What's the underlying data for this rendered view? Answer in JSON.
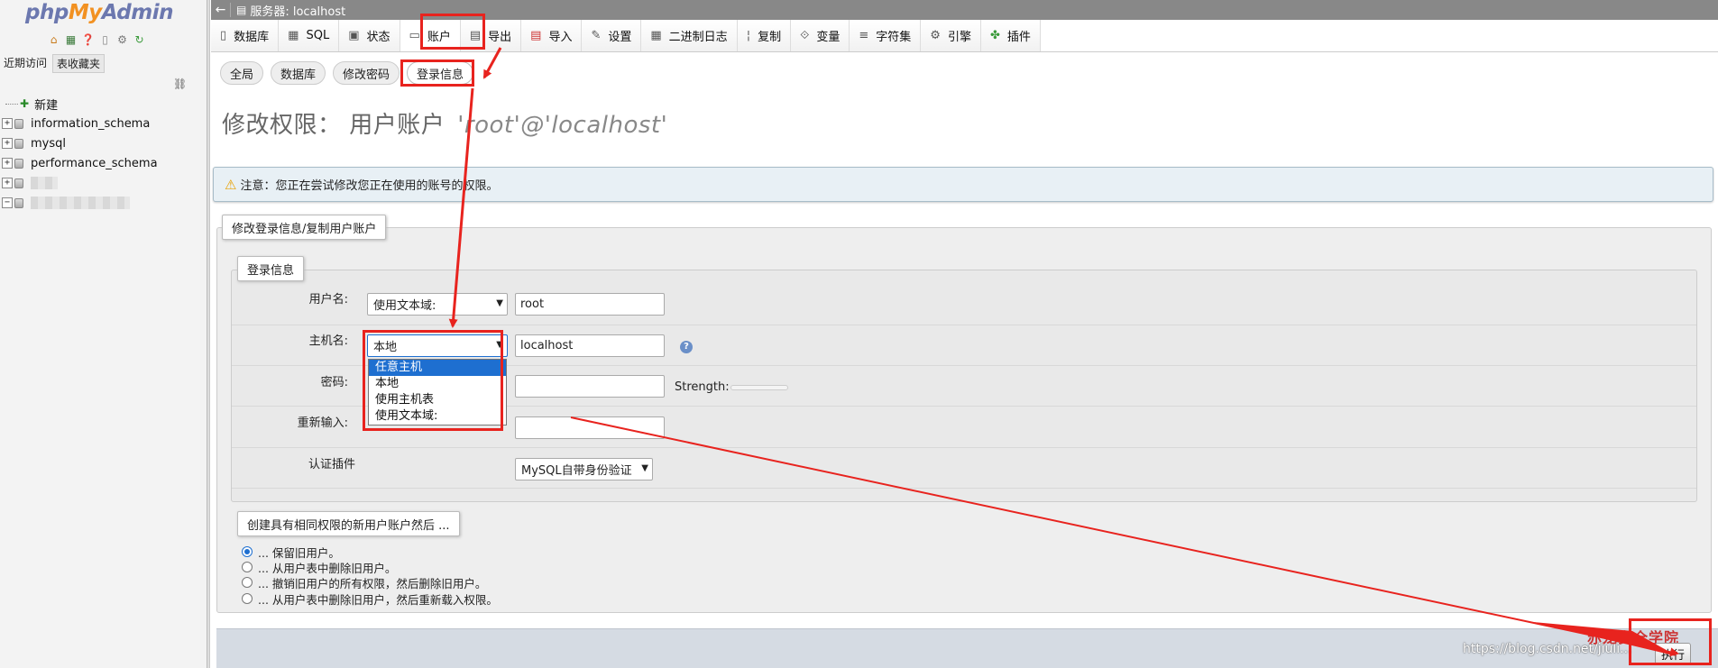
{
  "nav": {
    "logo_php": "php",
    "logo_my": "My",
    "logo_admin": "Admin",
    "icons": [
      "home-icon",
      "sql-icon",
      "help-icon",
      "docs-icon",
      "gear-icon",
      "reload-icon"
    ],
    "tab_recent": "近期访问",
    "tab_favorites": "表收藏夹",
    "tree": {
      "new": "新建",
      "databases": [
        "information_schema",
        "mysql",
        "performance_schema"
      ]
    }
  },
  "serverbar": {
    "title": "服务器: localhost"
  },
  "tabs": [
    {
      "label": "数据库",
      "icon": "database-icon"
    },
    {
      "label": "SQL",
      "icon": "sql-icon"
    },
    {
      "label": "状态",
      "icon": "status-icon"
    },
    {
      "label": "账户",
      "icon": "accounts-icon"
    },
    {
      "label": "导出",
      "icon": "export-icon"
    },
    {
      "label": "导入",
      "icon": "import-icon"
    },
    {
      "label": "设置",
      "icon": "settings-icon"
    },
    {
      "label": "二进制日志",
      "icon": "binlog-icon"
    },
    {
      "label": "复制",
      "icon": "replication-icon"
    },
    {
      "label": "变量",
      "icon": "variables-icon"
    },
    {
      "label": "字符集",
      "icon": "charset-icon"
    },
    {
      "label": "引擎",
      "icon": "engine-icon"
    },
    {
      "label": "插件",
      "icon": "plugin-icon"
    }
  ],
  "subtabs": [
    "全局",
    "数据库",
    "修改密码",
    "登录信息"
  ],
  "page": {
    "title": "修改权限：  用户账户",
    "account": "'root'@'localhost'"
  },
  "notice": {
    "text": "注意：您正在尝试修改您正在使用的账号的权限。"
  },
  "form": {
    "outer_legend": "修改登录信息/复制用户账户",
    "inner_legend": "登录信息",
    "username_label": "用户名:",
    "username_select": "使用文本域:",
    "username_value": "root",
    "host_label": "主机名:",
    "host_select": "本地",
    "host_value": "localhost",
    "password_label": "密码:",
    "strength_label": "Strength:",
    "retype_label": "重新输入:",
    "auth_label": "认证插件",
    "auth_select": "MySQL自带身份验证",
    "host_options": [
      "任意主机",
      "本地",
      "使用主机表",
      "使用文本域:"
    ]
  },
  "create": {
    "legend": "创建具有相同权限的新用户账户然后 ...",
    "options": [
      "... 保留旧用户。",
      "... 从用户表中删除旧用户。",
      "... 撤销旧用户的所有权限，然后删除旧用户。",
      "... 从用户表中删除旧用户，然后重新载入权限。"
    ]
  },
  "footer": {
    "go_label": "执行",
    "watermark_url": "https://blog.csdn.net/jiuli...",
    "watermark_logo": "赤龙安全学院"
  },
  "colors": {
    "annotation": "#e8231e",
    "highlight": "#1e6fd0"
  }
}
